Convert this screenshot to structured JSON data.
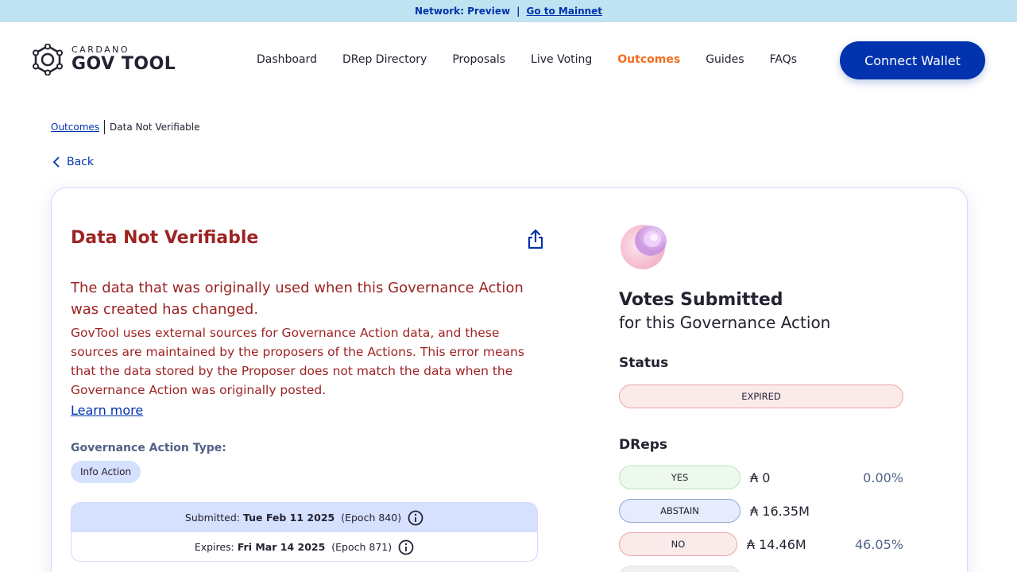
{
  "network_banner": {
    "network_text": "Network: Preview",
    "separator": "|",
    "link_text": "Go to Mainnet"
  },
  "logo": {
    "small_text": "CARDANO",
    "big_text": "GOV TOOL"
  },
  "nav": {
    "items": [
      {
        "label": "Dashboard"
      },
      {
        "label": "DRep Directory"
      },
      {
        "label": "Proposals"
      },
      {
        "label": "Live Voting"
      },
      {
        "label": "Outcomes"
      },
      {
        "label": "Guides"
      },
      {
        "label": "FAQs"
      }
    ],
    "active": "Outcomes",
    "connect_label": "Connect Wallet"
  },
  "breadcrumb": {
    "parent": "Outcomes",
    "current": "Data Not Verifiable"
  },
  "back_label": "Back",
  "action": {
    "title": "Data Not Verifiable",
    "error_heading": "The data that was originally used when this Governance Action was created has changed.",
    "error_body": "GovTool uses external sources for Governance Action data, and these sources are maintained by the proposers of the Actions. This error means that the data stored by the Proposer does not match the data when the Governance Action was originally posted.",
    "learn_more": "Learn more",
    "type_label": "Governance Action Type:",
    "type_value": "Info Action",
    "submitted": {
      "label": "Submitted:",
      "date": "Tue Feb 11 2025",
      "epoch": "(Epoch 840)"
    },
    "expires": {
      "label": "Expires:",
      "date": "Fri Mar 14 2025",
      "epoch": "(Epoch 871)"
    }
  },
  "votes": {
    "title": "Votes Submitted",
    "subtitle": "for this Governance Action",
    "status_label": "Status",
    "status_value": "EXPIRED",
    "dreps_label": "DReps",
    "rows": [
      {
        "label": "YES",
        "amount": "₳ 0",
        "percent": "0.00%"
      },
      {
        "label": "ABSTAIN",
        "amount": "₳ 16.35M",
        "percent": ""
      },
      {
        "label": "NO",
        "amount": "₳ 14.46M",
        "percent": "46.05%"
      }
    ]
  },
  "colors": {
    "brand_blue": "#0033ad",
    "active_nav": "#f06f1f",
    "error_red": "#9e2323",
    "banner_bg": "#bfe3f1"
  }
}
